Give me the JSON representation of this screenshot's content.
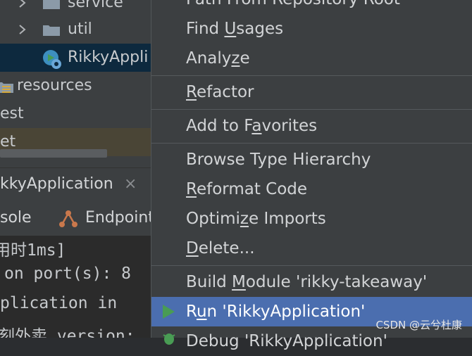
{
  "tree": [
    {
      "label": "service",
      "type": "folder"
    },
    {
      "label": "util",
      "type": "folder"
    },
    {
      "label": "RikkyAppli",
      "type": "spring-class"
    },
    {
      "label": "resources",
      "type": "folder-resources"
    },
    {
      "label": "est",
      "type": "text"
    },
    {
      "label": "et",
      "type": "text"
    }
  ],
  "run_tab": {
    "label": "kkyApplication",
    "close": "×"
  },
  "sub_tabs": {
    "console": "sole",
    "endpoints": "Endpoint"
  },
  "console_lines": [
    "用时1ms]",
    "on port(s): 8",
    "plication in ",
    "刻外卖 version:"
  ],
  "menu": {
    "partial_top": "Path From Repository Root",
    "find_usages": {
      "pre": "Find ",
      "u": "U",
      "post": "sages"
    },
    "analyze": {
      "pre": "Analy",
      "u": "z",
      "post": "e"
    },
    "refactor": {
      "pre": "",
      "u": "R",
      "post": "efactor"
    },
    "add_favorites": {
      "pre": "Add to F",
      "u": "a",
      "post": "vorites"
    },
    "browse_hierarchy": {
      "pre": "Browse Type Hierarchy",
      "u": "",
      "post": ""
    },
    "reformat": {
      "pre": "",
      "u": "R",
      "post": "eformat Code"
    },
    "optimize": {
      "pre": "Optimi",
      "u": "z",
      "post": "e Imports"
    },
    "delete": {
      "pre": "",
      "u": "D",
      "post": "elete..."
    },
    "build_module": {
      "pre": "Build ",
      "u": "M",
      "post": "odule 'rikky-takeaway'"
    },
    "run": {
      "pre": "R",
      "u": "u",
      "post": "n 'RikkyApplication'"
    },
    "debug_partial": "Debug 'RikkyApplication'"
  },
  "watermark": "CSDN @云兮杜康",
  "colors": {
    "selection": "#4b6eaf",
    "run_icon": "#499c54",
    "folder": "#8b9aa8"
  }
}
